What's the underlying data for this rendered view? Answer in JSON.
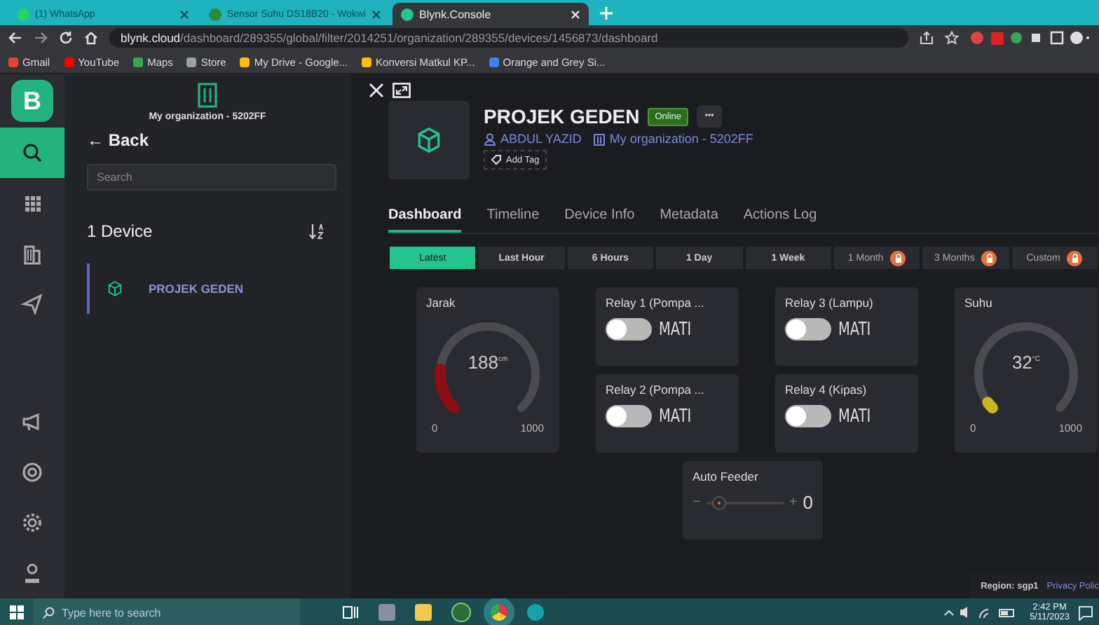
{
  "browser": {
    "tabs": [
      {
        "title": "(1) WhatsApp",
        "kind": "whatsapp",
        "selected": false
      },
      {
        "title": "Sensor Suhu DS18B20 - Wokwi",
        "kind": "wokwi",
        "selected": false
      },
      {
        "title": "Blynk.Console",
        "kind": "blynk",
        "selected": true
      }
    ],
    "url_host": "blynk.cloud",
    "url_path": "/dashboard/289355/global/filter/2014251/organization/289355/devices/1456873/dashboard",
    "bookmarks": [
      {
        "label": "Gmail",
        "kind": "gmail"
      },
      {
        "label": "YouTube",
        "kind": "youtube"
      },
      {
        "label": "Maps",
        "kind": "maps"
      },
      {
        "label": "Store",
        "kind": "store"
      },
      {
        "label": "My Drive - Google...",
        "kind": "drive"
      },
      {
        "label": "Konversi Matkul KP...",
        "kind": "drive"
      },
      {
        "label": "Orange and Grey Si...",
        "kind": "canva"
      }
    ]
  },
  "rail": {
    "logo": "B",
    "items": [
      {
        "kind": "search",
        "selected": true
      },
      {
        "kind": "grid",
        "selected": false
      },
      {
        "kind": "building",
        "selected": false
      },
      {
        "kind": "plane",
        "selected": false
      },
      {
        "kind": "megaphone",
        "selected": false
      },
      {
        "kind": "lifebuoy",
        "selected": false
      },
      {
        "kind": "gear",
        "selected": false
      },
      {
        "kind": "user",
        "selected": false
      }
    ]
  },
  "panel": {
    "organization": "My organization - 5202FF",
    "back": "← Back",
    "search": {
      "placeholder": "Search"
    },
    "device_count": "1 Device",
    "devices": [
      {
        "name": "PROJEK GEDEN",
        "selected": true
      }
    ]
  },
  "device": {
    "name": "PROJEK GEDEN",
    "status": "Online",
    "owner": "ABDUL YAZID",
    "organization": "My organization - 5202FF",
    "add_tag": "Add Tag",
    "more": "•••"
  },
  "tabs": [
    {
      "label": "Dashboard",
      "selected": true
    },
    {
      "label": "Timeline",
      "selected": false
    },
    {
      "label": "Device Info",
      "selected": false
    },
    {
      "label": "Metadata",
      "selected": false
    },
    {
      "label": "Actions Log",
      "selected": false
    }
  ],
  "ranges": [
    {
      "label": "Latest",
      "selected": true,
      "locked": false
    },
    {
      "label": "Last Hour",
      "selected": false,
      "locked": false
    },
    {
      "label": "6 Hours",
      "selected": false,
      "locked": false
    },
    {
      "label": "1 Day",
      "selected": false,
      "locked": false
    },
    {
      "label": "1 Week",
      "selected": false,
      "locked": false
    },
    {
      "label": "1 Month",
      "selected": false,
      "locked": true
    },
    {
      "label": "3 Months",
      "selected": false,
      "locked": true
    },
    {
      "label": "Custom",
      "selected": false,
      "locked": true
    }
  ],
  "widgets": [
    {
      "kind": "gauge",
      "title": "Jarak",
      "value": "188",
      "unit": "cm",
      "min": "0",
      "max": "1000",
      "color": "#8b0f12"
    },
    {
      "kind": "switch",
      "title": "Relay 1 (Pompa ...",
      "on": false,
      "state": "MATI"
    },
    {
      "kind": "switch",
      "title": "Relay 3 (Lampu)",
      "on": false,
      "state": "MATI"
    },
    {
      "kind": "gauge",
      "title": "Suhu",
      "value": "32",
      "unit": "°C",
      "min": "0",
      "max": "1000",
      "color": "#c9b61c"
    },
    {
      "kind": "switch",
      "title": "Relay 2 (Pompa ...",
      "on": false,
      "state": "MATI"
    },
    {
      "kind": "switch",
      "title": "Relay 4 (Kipas)",
      "on": false,
      "state": "MATI"
    },
    {
      "kind": "slider",
      "title": "Auto Feeder",
      "minus": "−",
      "plus": "+",
      "value": "0"
    }
  ],
  "footer": {
    "region": "Region: sgp1",
    "privacy": "Privacy Polic"
  },
  "taskbar": {
    "search": {
      "placeholder": "Type here to search"
    },
    "time": "2:42 PM",
    "date": "5/11/2023"
  }
}
